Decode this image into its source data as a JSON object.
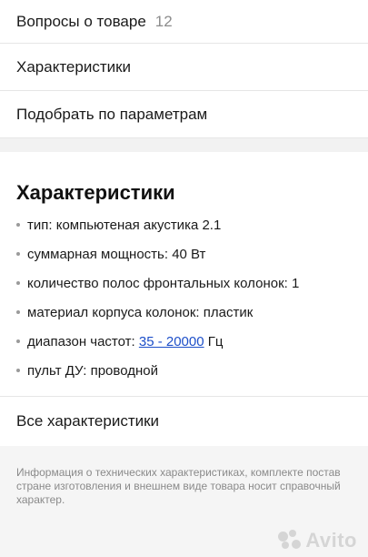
{
  "menu": {
    "questions_label": "Вопросы о товаре",
    "questions_count": "12",
    "characteristics_label": "Характеристики",
    "filter_label": "Подобрать по параметрам"
  },
  "specs": {
    "title": "Характеристики",
    "items": [
      {
        "text": "тип: компьютеная акустика 2.1"
      },
      {
        "text": "суммарная мощность: 40 Вт"
      },
      {
        "text": "количество полос фронтальных колонок: 1"
      },
      {
        "text": "материал корпуса колонок: пластик"
      },
      {
        "prefix": "диапазон частот: ",
        "link": "35 - 20000",
        "suffix": " Гц"
      },
      {
        "text": "пульт ДУ: проводной"
      }
    ],
    "all_label": "Все характеристики"
  },
  "disclaimer": {
    "line1": "Информация о технических характеристиках, комплекте постав",
    "line2": "стране изготовления и внешнем виде товара носит справочный",
    "line3": "характер."
  },
  "watermark": {
    "text": "Avito"
  }
}
